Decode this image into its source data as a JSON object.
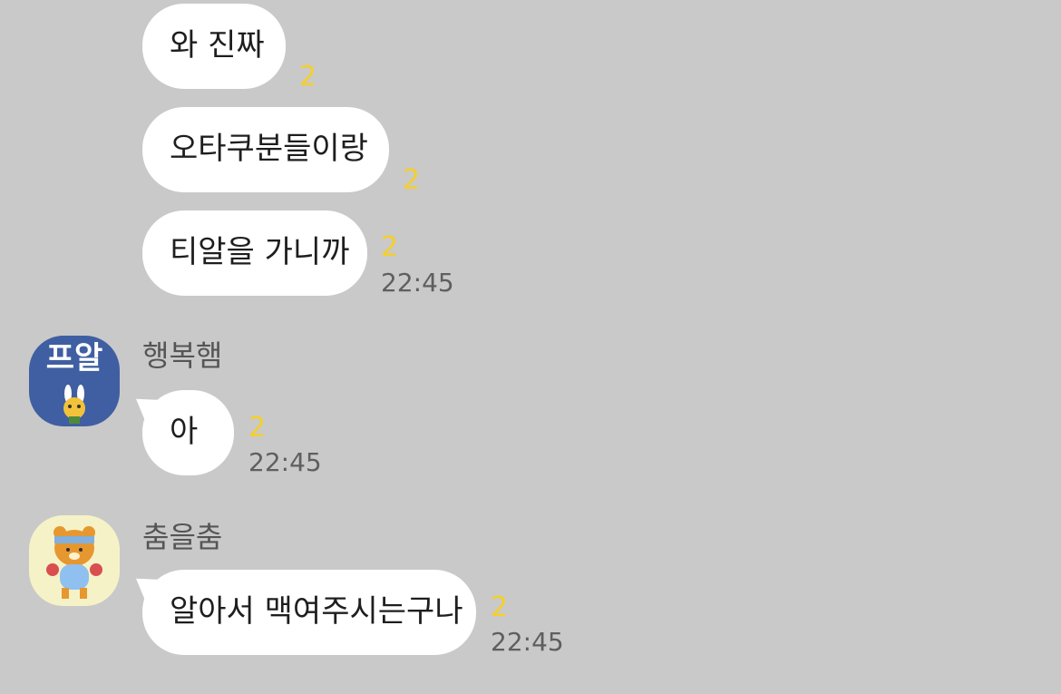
{
  "colors": {
    "background": "#c9c9c9",
    "bubble": "#ffffff",
    "unread": "#f5cf2a",
    "time": "#5f5f5f",
    "sender": "#555555",
    "avatar_1_bg": "#3f5fa2",
    "avatar_2_bg": "#f6f2c8"
  },
  "messages": [
    {
      "text": "와 진짜",
      "unread": "2"
    },
    {
      "text": "오타쿠분들이랑",
      "unread": "2"
    },
    {
      "text": "티알을 가니까",
      "unread": "2",
      "time": "22:45"
    },
    {
      "sender": "행복햄",
      "avatar_icon": "sticker-avatar-icon",
      "avatar_label": "프알",
      "text": "아",
      "unread": "2",
      "time": "22:45"
    },
    {
      "sender": "춤을춤",
      "avatar_icon": "bear-avatar-icon",
      "text": "알아서 맥여주시는구나",
      "unread": "2",
      "time": "22:45"
    }
  ]
}
